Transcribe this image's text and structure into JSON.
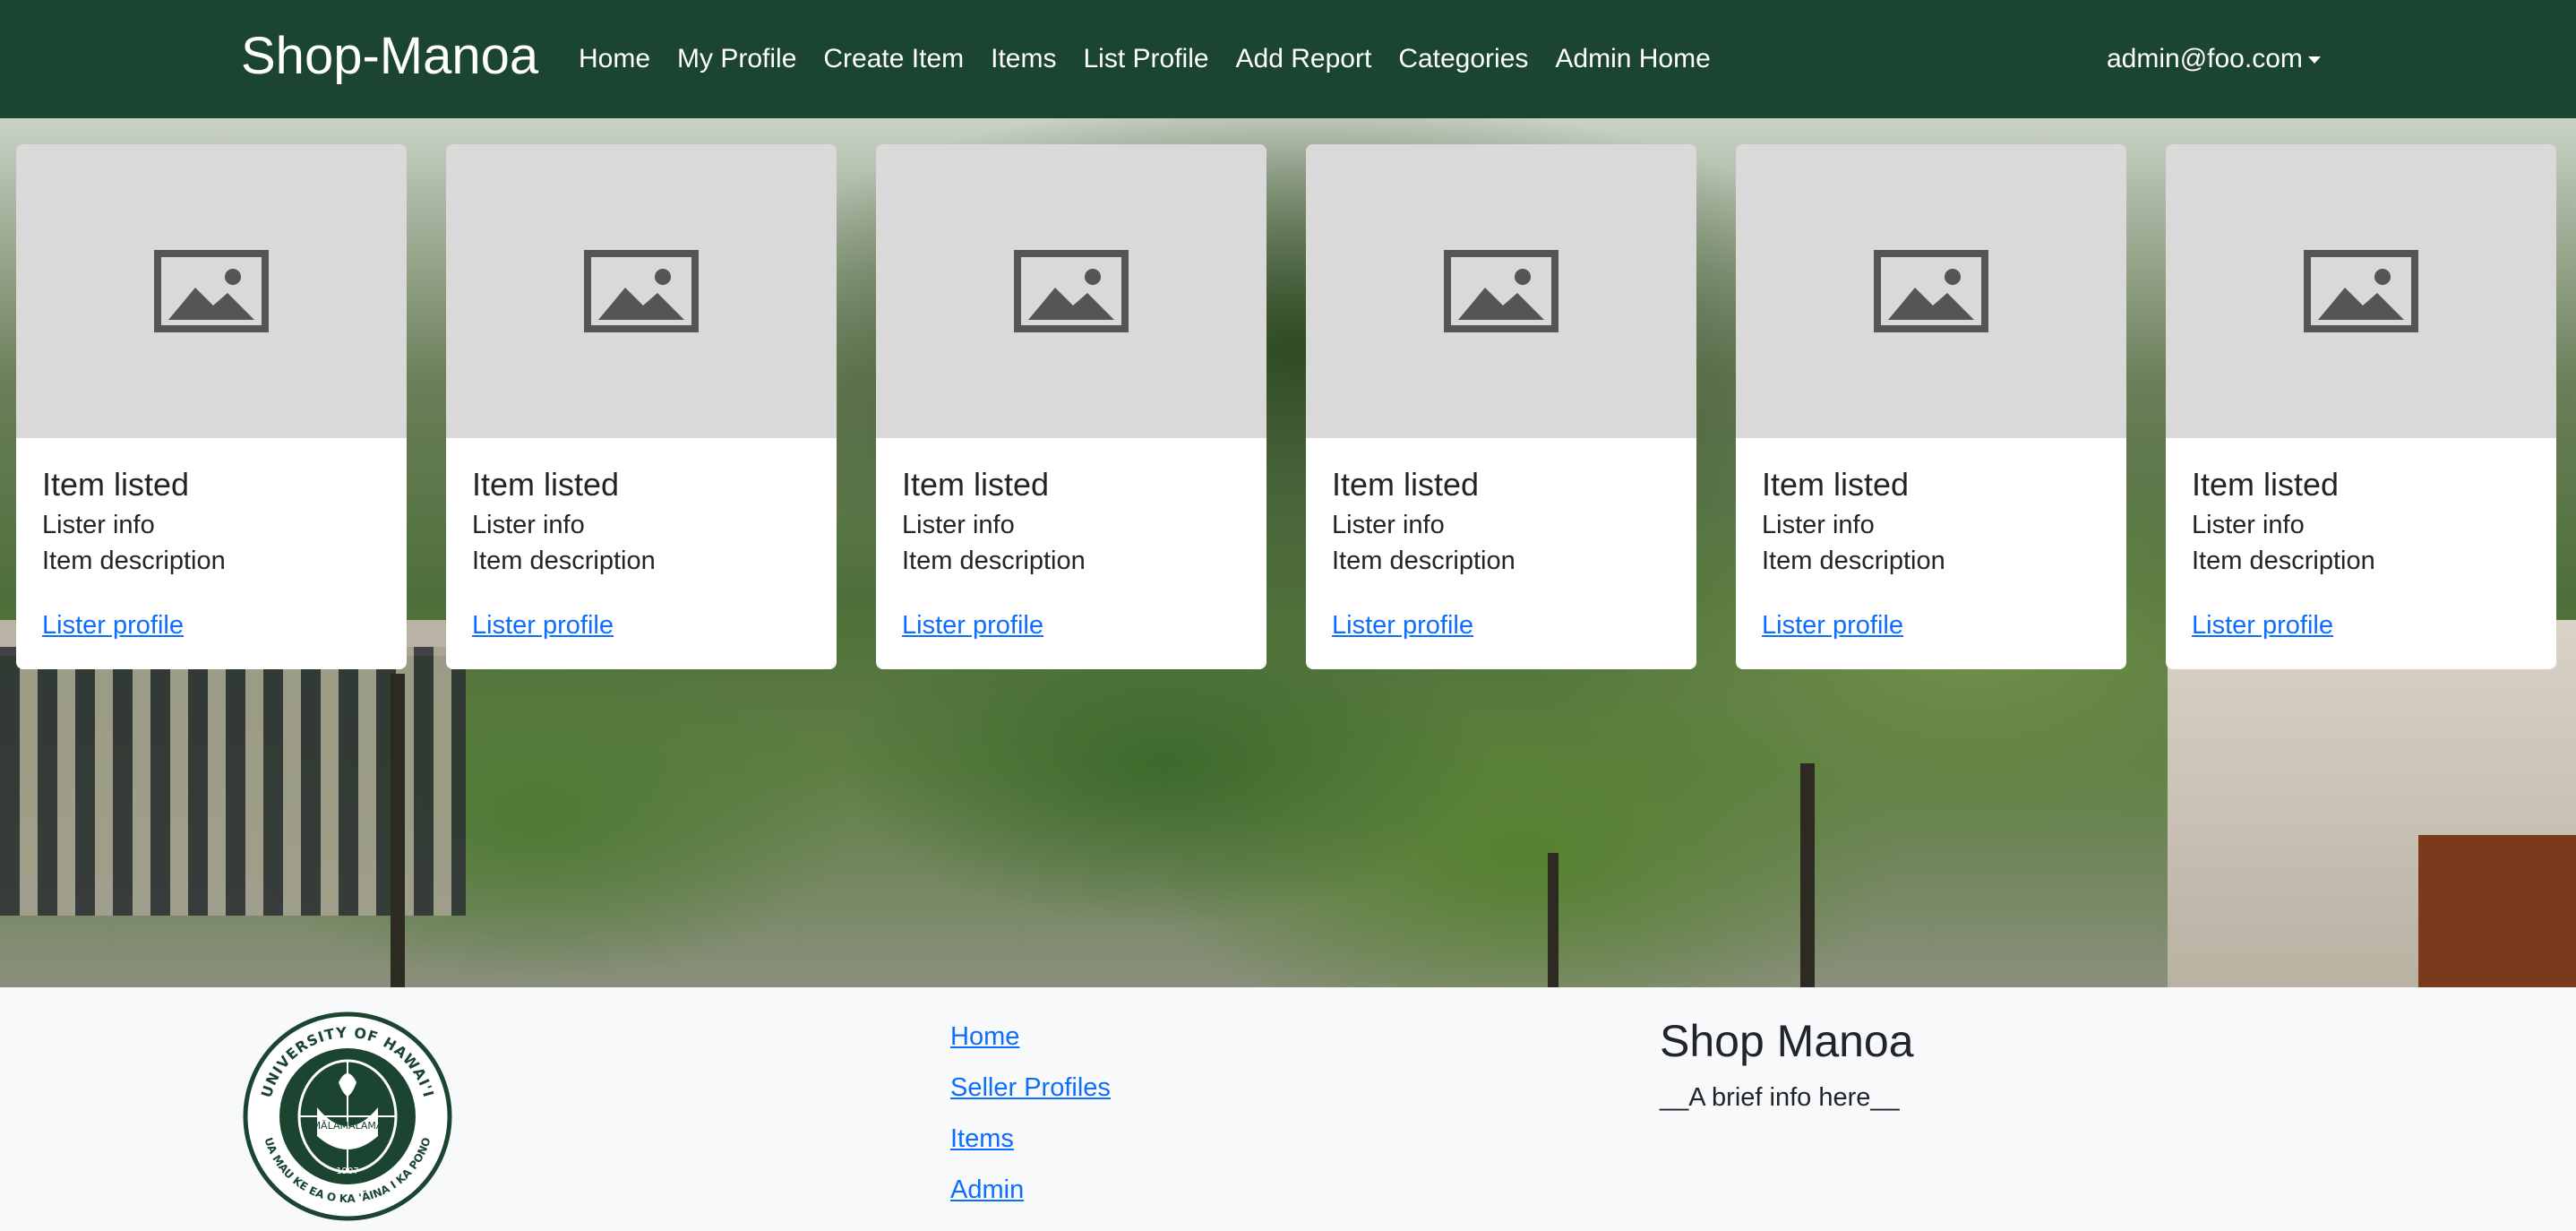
{
  "navbar": {
    "brand": "Shop-Manoa",
    "links": [
      "Home",
      "My Profile",
      "Create Item",
      "Items",
      "List Profile",
      "Add Report",
      "Categories",
      "Admin Home"
    ],
    "user": "admin@foo.com"
  },
  "cards": [
    {
      "title": "Item listed",
      "lister": "Lister info",
      "description": "Item description",
      "link": "Lister profile",
      "image_icon": "image-placeholder-icon"
    },
    {
      "title": "Item listed",
      "lister": "Lister info",
      "description": "Item description",
      "link": "Lister profile",
      "image_icon": "image-placeholder-icon"
    },
    {
      "title": "Item listed",
      "lister": "Lister info",
      "description": "Item description",
      "link": "Lister profile",
      "image_icon": "image-placeholder-icon"
    },
    {
      "title": "Item listed",
      "lister": "Lister info",
      "description": "Item description",
      "link": "Lister profile",
      "image_icon": "image-placeholder-icon"
    },
    {
      "title": "Item listed",
      "lister": "Lister info",
      "description": "Item description",
      "link": "Lister profile",
      "image_icon": "image-placeholder-icon"
    },
    {
      "title": "Item listed",
      "lister": "Lister info",
      "description": "Item description",
      "link": "Lister profile",
      "image_icon": "image-placeholder-icon"
    }
  ],
  "footer": {
    "seal_text_top": "UNIVERSITY OF HAWAI'I",
    "seal_text_bottom": "UA MAU KE EA O KA 'ĀINA I KA PONO",
    "seal_motto": "MĀLAMALAMA",
    "seal_year": "1907",
    "links": [
      "Home",
      "Seller Profiles",
      "Items",
      "Admin"
    ],
    "title": "Shop Manoa",
    "info": "__A brief info here__"
  },
  "colors": {
    "navbar_bg": "#1c4531",
    "link": "#0d6efd",
    "card_image_bg": "#d9d9d9",
    "footer_bg": "#f8f9fa"
  }
}
